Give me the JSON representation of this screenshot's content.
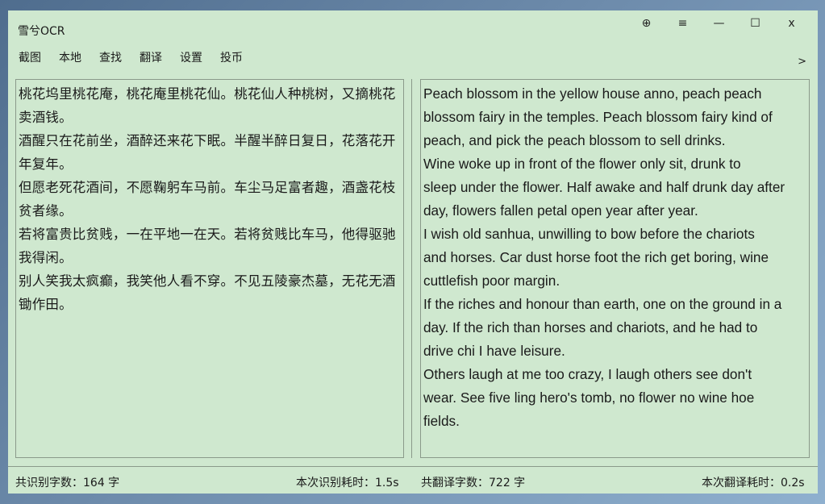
{
  "app": {
    "title": "雪兮OCR"
  },
  "window_controls": [
    {
      "name": "pin-button",
      "glyph": "⊕"
    },
    {
      "name": "menu-button",
      "glyph": "≡"
    },
    {
      "name": "minimize-button",
      "glyph": "—"
    },
    {
      "name": "maximize-button",
      "glyph": "☐"
    },
    {
      "name": "close-button",
      "glyph": "x"
    }
  ],
  "menu": {
    "items": [
      "截图",
      "本地",
      "查找",
      "翻译",
      "设置",
      "投币"
    ],
    "expand_label": ">"
  },
  "source_text": {
    "lines": [
      "桃花坞里桃花庵，桃花庵里桃花仙。桃花仙人种桃树，又摘桃花",
      "卖酒钱。",
      "酒醒只在花前坐，酒醉还来花下眠。半醒半醉日复日，花落花开",
      "年复年。",
      "但愿老死花酒间，不愿鞠躬车马前。车尘马足富者趣，酒盏花枝",
      "贫者缘。",
      "若将富贵比贫贱，一在平地一在天。若将贫贱比车马，他得驱驰",
      "我得闲。",
      "别人笑我太疯癫，我笑他人看不穿。不见五陵豪杰墓，无花无酒",
      "锄作田。"
    ]
  },
  "translated_text": {
    "lines": [
      "Peach blossom in the yellow house anno, peach peach",
      "blossom fairy in the temples. Peach blossom fairy kind of",
      "peach, and pick the peach blossom to sell drinks.",
      "Wine woke up in front of the flower only sit, drunk to",
      "sleep under the flower. Half awake and half drunk day after",
      "day, flowers fallen petal open year after year.",
      "I wish old sanhua, unwilling to bow before the chariots",
      "and horses. Car dust horse foot the rich get boring, wine",
      "cuttlefish poor margin.",
      "If the riches and honour than earth, one on the ground in a",
      "day. If the rich than horses and chariots, and he had to",
      "drive chi I have leisure.",
      "Others laugh at me too crazy, I laugh others see don't",
      "wear. See five ling hero's tomb, no flower no wine hoe",
      "fields."
    ]
  },
  "status": {
    "ocr_count": "共识别字数：164 字",
    "ocr_time": "本次识别耗时：1.5s",
    "trans_count": "共翻译字数：722 字",
    "trans_time": "本次翻译耗时：0.2s"
  }
}
